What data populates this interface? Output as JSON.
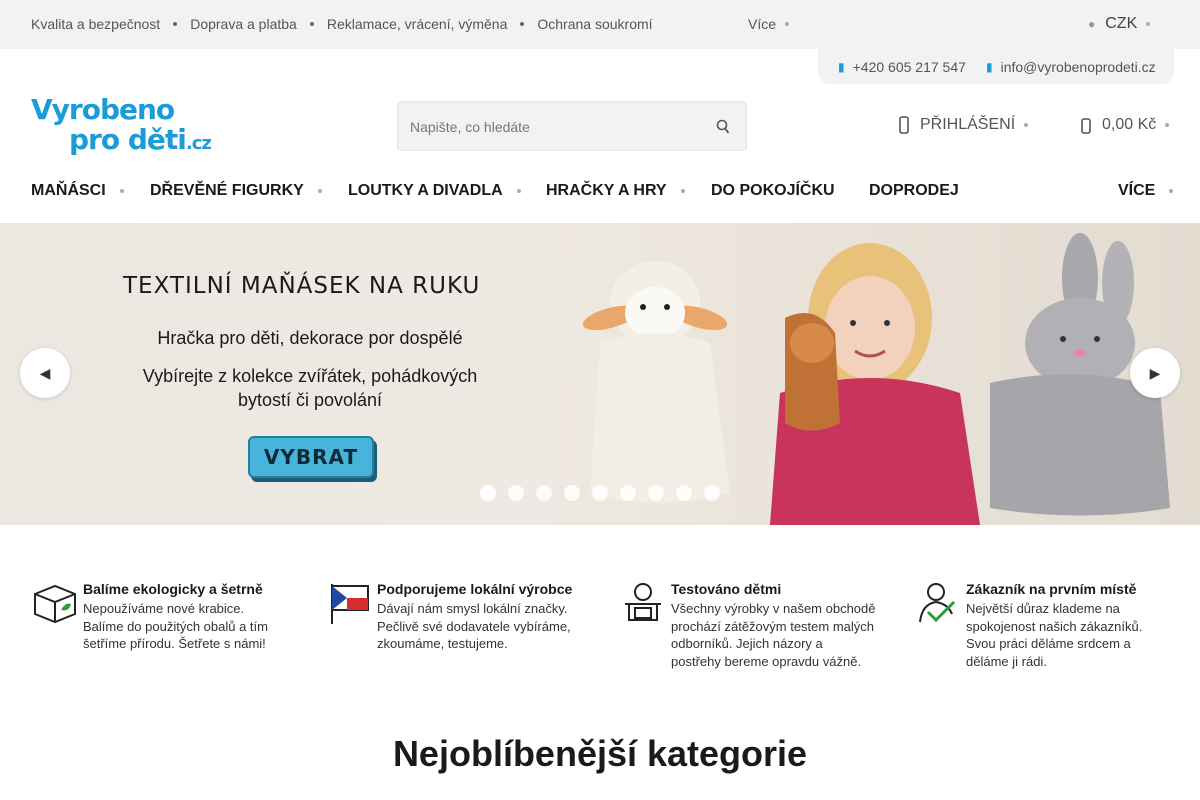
{
  "topbar": {
    "links": [
      "Kvalita a bezpečnost",
      "Doprava a platba",
      "Reklamace, vrácení, výměna",
      "Ochrana soukromí"
    ],
    "more_label": "Více",
    "currency": "CZK"
  },
  "contact": {
    "phone": "+420 605 217 547",
    "email": "info@vyrobenoprodeti.cz"
  },
  "logo": {
    "line1": "Vyrobeno",
    "line2": "pro děti",
    "tld": ".cz"
  },
  "search": {
    "placeholder": "Napište, co hledáte"
  },
  "account": {
    "login_label": "PŘIHLÁŠENÍ"
  },
  "cart": {
    "total": "0,00 Kč"
  },
  "nav": {
    "items": [
      "MAŇÁSCI",
      "DŘEVĚNÉ FIGURKY",
      "LOUTKY A DIVADLA",
      "HRAČKY A HRY",
      "DO POKOJÍČKU",
      "DOPRODEJ"
    ],
    "more_label": "VÍCE"
  },
  "hero": {
    "title": "TEXTILNÍ MAŇÁSEK NA RUKU",
    "subtitle": "Hračka pro děti, dekorace por dospělé",
    "description": "Vybírejte z kolekce zvířátek, pohádkových bytostí či povolání",
    "cta_label": "VYBRAT",
    "slide_count": 9,
    "active_slide": 1
  },
  "benefits": [
    {
      "icon": "eco-box-icon",
      "title": "Balíme ekologicky a šetrně",
      "text": "Nepoužíváme nové krabice. Balíme do použitých obalů a tím šetříme přírodu. Šetřete s námi!"
    },
    {
      "icon": "czech-flag-icon",
      "title": "Podporujeme lokální výrobce",
      "text": "Dávají nám smysl lokální značky. Pečlivě své dodavatele vybíráme, zkoumáme, testujeme."
    },
    {
      "icon": "child-tested-icon",
      "title": "Testováno dětmi",
      "text": "Všechny výrobky v našem obchodě prochází zátěžovým testem malých odborníků. Jejich názory a postřehy bereme opravdu vážně."
    },
    {
      "icon": "customer-check-icon",
      "title": "Zákazník na prvním místě",
      "text": "Největší důraz klademe na spokojenost našich zákazníků. Svou práci děláme srdcem a děláme ji rádi."
    }
  ],
  "section": {
    "title": "Nejoblíbenější kategorie"
  },
  "colors": {
    "brand_blue": "#1b9bd7",
    "topbar_bg": "#f1f2f4",
    "cta_blue": "#48b4dc"
  }
}
